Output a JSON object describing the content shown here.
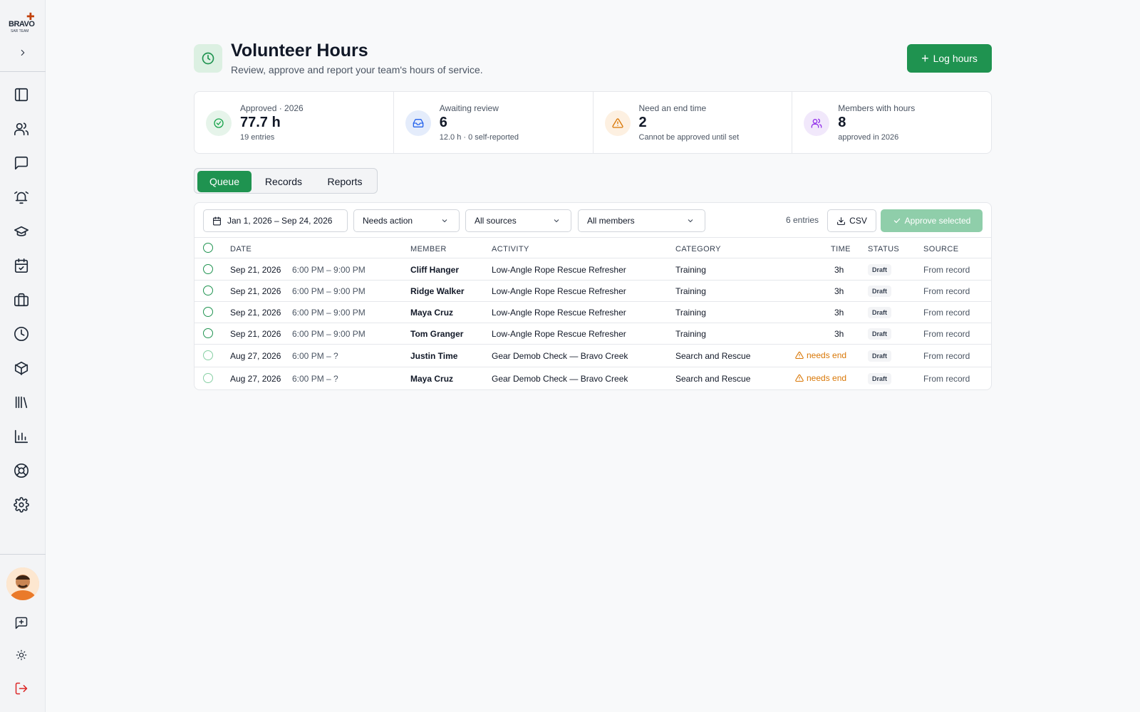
{
  "sidebar": {
    "logo_text": "BRAVO",
    "logo_sub": "SAR TEAM",
    "nav_icons": [
      "panel-icon",
      "users-icon",
      "chat-icon",
      "alarm-icon",
      "graduation-cap-icon",
      "calendar-check-icon",
      "briefcase-icon",
      "clock-icon",
      "package-icon",
      "library-icon",
      "bar-chart-icon",
      "life-buoy-icon",
      "gear-icon"
    ],
    "bottom_icons": [
      "feedback-icon",
      "sun-icon",
      "logout-icon"
    ]
  },
  "header": {
    "title": "Volunteer Hours",
    "subtitle": "Review, approve and report your team's hours of service.",
    "log_button": "Log hours"
  },
  "stats": [
    {
      "label": "Approved · 2026",
      "value": "77.7 h",
      "sub": "19 entries",
      "icon": "check-circle-icon",
      "color": "#16a34a",
      "bg": "#e6f4ea"
    },
    {
      "label": "Awaiting review",
      "value": "6",
      "sub": "12.0 h · 0 self-reported",
      "icon": "inbox-icon",
      "color": "#2563eb",
      "bg": "#e4ecfb"
    },
    {
      "label": "Need an end time",
      "value": "2",
      "sub": "Cannot be approved until set",
      "icon": "warning-icon",
      "color": "#d97706",
      "bg": "#fdf0e1"
    },
    {
      "label": "Members with hours",
      "value": "8",
      "sub": "approved in 2026",
      "icon": "users-icon",
      "color": "#9333ea",
      "bg": "#f1e8fb"
    }
  ],
  "tabs": [
    "Queue",
    "Records",
    "Reports"
  ],
  "filters": {
    "date_range": "Jan 1, 2026 – Sep 24, 2026",
    "status": "Needs action",
    "source": "All sources",
    "members": "All members"
  },
  "toolbar": {
    "entries": "6 entries",
    "csv": "CSV",
    "approve": "Approve selected"
  },
  "columns": [
    "DATE",
    "MEMBER",
    "ACTIVITY",
    "CATEGORY",
    "TIME",
    "STATUS",
    "SOURCE"
  ],
  "rows": [
    {
      "date": "Sep 21, 2026",
      "time_range": "6:00 PM – 9:00 PM",
      "member": "Cliff Hanger",
      "activity": "Low-Angle Rope Rescue Refresher",
      "category": "Training",
      "time": "3h",
      "status": "Draft",
      "source": "From record"
    },
    {
      "date": "Sep 21, 2026",
      "time_range": "6:00 PM – 9:00 PM",
      "member": "Ridge Walker",
      "activity": "Low-Angle Rope Rescue Refresher",
      "category": "Training",
      "time": "3h",
      "status": "Draft",
      "source": "From record"
    },
    {
      "date": "Sep 21, 2026",
      "time_range": "6:00 PM – 9:00 PM",
      "member": "Maya Cruz",
      "activity": "Low-Angle Rope Rescue Refresher",
      "category": "Training",
      "time": "3h",
      "status": "Draft",
      "source": "From record"
    },
    {
      "date": "Sep 21, 2026",
      "time_range": "6:00 PM – 9:00 PM",
      "member": "Tom Granger",
      "activity": "Low-Angle Rope Rescue Refresher",
      "category": "Training",
      "time": "3h",
      "status": "Draft",
      "source": "From record"
    },
    {
      "date": "Aug 27, 2026",
      "time_range": "6:00 PM – ?",
      "member": "Justin Time",
      "activity": "Gear Demob Check — Bravo Creek",
      "category": "Search and Rescue",
      "time": "needs end",
      "status": "Draft",
      "source": "From record"
    },
    {
      "date": "Aug 27, 2026",
      "time_range": "6:00 PM – ?",
      "member": "Maya Cruz",
      "activity": "Gear Demob Check — Bravo Creek",
      "category": "Search and Rescue",
      "time": "needs end",
      "status": "Draft",
      "source": "From record"
    }
  ]
}
